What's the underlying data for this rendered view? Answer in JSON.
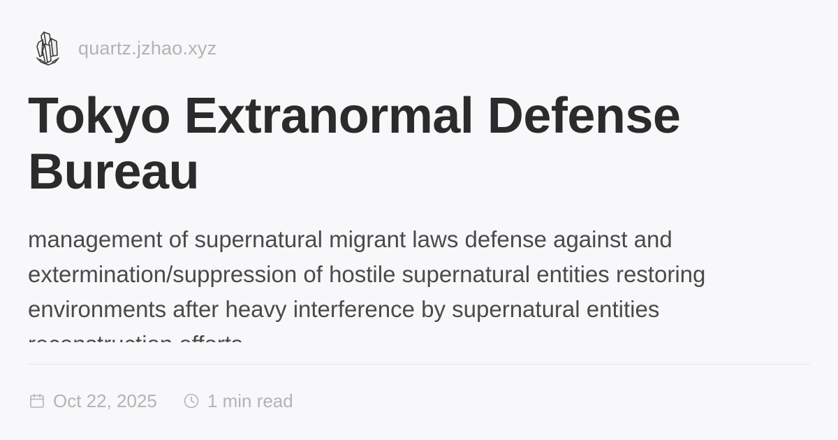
{
  "site": {
    "logo_icon": "crystal-logo-icon",
    "name": "quartz.jzhao.xyz"
  },
  "article": {
    "title": "Tokyo Extranormal Defense Bureau",
    "description": "management of supernatural migrant laws defense against and extermination/suppression of hostile supernatural entities restoring environments after heavy interference by supernatural entities reconstruction efforts"
  },
  "meta": {
    "date_icon": "calendar-icon",
    "date": "Oct 22, 2025",
    "reading_time_icon": "clock-icon",
    "reading_time": "1 min read"
  },
  "colors": {
    "background": "#f8f8fa",
    "title": "#2b2b2b",
    "description": "#4a4a4a",
    "muted": "#b3b3b3",
    "divider": "#e6e6e8"
  }
}
